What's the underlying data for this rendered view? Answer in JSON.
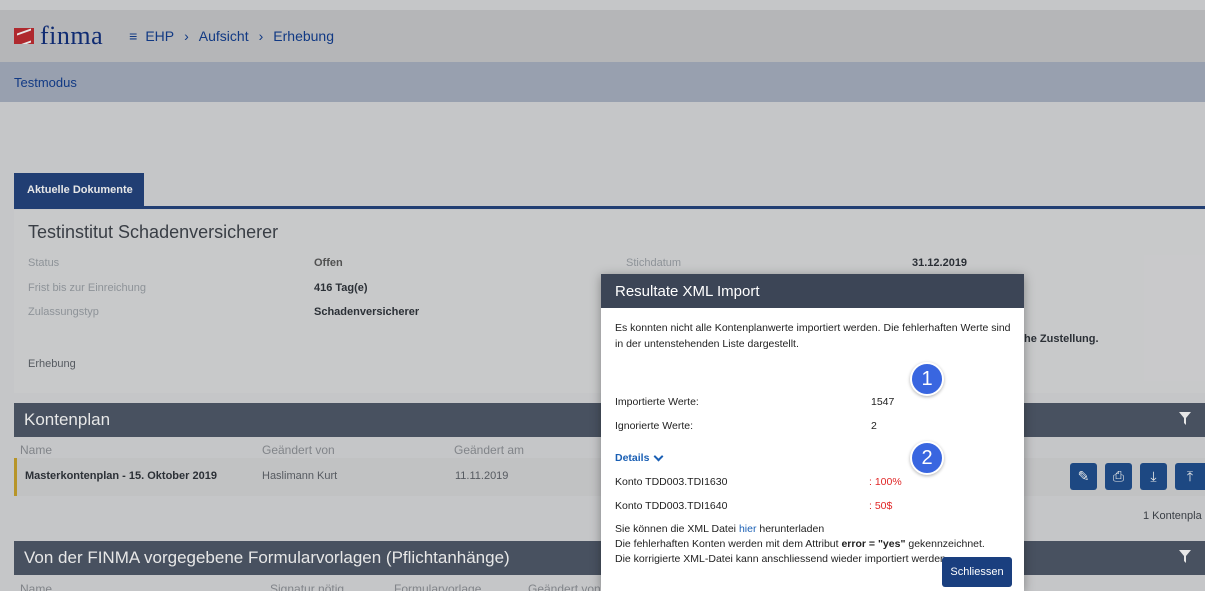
{
  "app": {
    "logo_text": "finma",
    "breadcrumb": [
      "EHP",
      "Aufsicht",
      "Erhebung"
    ]
  },
  "mode_label": "Testmodus",
  "tabs": [
    {
      "label": "Aktuelle Dokumente",
      "active": true
    }
  ],
  "institute": {
    "title": "Testinstitut Schadenversicherer",
    "fields": [
      {
        "label": "Status",
        "value": "Offen"
      },
      {
        "label": "Frist bis zur Einreichung",
        "value": "416 Tag(e)"
      },
      {
        "label": "Zulassungstyp",
        "value": "Schadenversicherer"
      },
      {
        "label": "Erhebung",
        "value": ""
      }
    ],
    "right_fields": [
      {
        "label": "Stichdatum",
        "value": "31.12.2019"
      }
    ],
    "partial_text": "he Zustellung."
  },
  "kontenplan": {
    "title": "Kontenplan",
    "columns": [
      "Name",
      "Geändert von",
      "Geändert am"
    ],
    "rows": [
      {
        "name": "Masterkontenplan - 15. Oktober 2019",
        "changed_by": "Haslimann Kurt",
        "changed_at": "11.11.2019"
      }
    ],
    "footer_count": "1 Kontenpla"
  },
  "formvorlagen": {
    "title": "Von der FINMA vorgegebene Formularvorlagen (Pflichtanhänge)",
    "columns": [
      "Name",
      "Signatur nötig",
      "Formularvorlage",
      "Geändert von"
    ]
  },
  "modal": {
    "title": "Resultate XML Import",
    "intro": "Es konnten nicht alle Kontenplanwerte importiert werden. Die fehlerhaften Werte sind in der untenstehenden Liste dargestellt.",
    "imported_label": "Importierte Werte:",
    "imported_value": "1547",
    "ignored_label": "Ignorierte Werte:",
    "ignored_value": "2",
    "details_label": "Details",
    "errors": [
      {
        "konto": "Konto TDD003.TDI1630",
        "value": ": 100%"
      },
      {
        "konto": "Konto TDD003.TDI1640",
        "value": ": 50$"
      }
    ],
    "download_pre": "Sie können die XML Datei ",
    "download_link": "hier",
    "download_post": " herunterladen",
    "attr_pre": "Die fehlerhaften Konten werden mit dem Attribut ",
    "attr_bold": "error = \"yes\"",
    "attr_post": " gekennzeichnet.",
    "reimport_text": "Die korrigierte XML-Datei kann anschliessend wieder importiert werden.",
    "close_label": "Schliessen"
  },
  "callouts": [
    "1",
    "2"
  ],
  "colors": {
    "primary": "#1a3f7f",
    "error": "#e02626",
    "link": "#1a5fb4",
    "callout": "#3966e0"
  }
}
